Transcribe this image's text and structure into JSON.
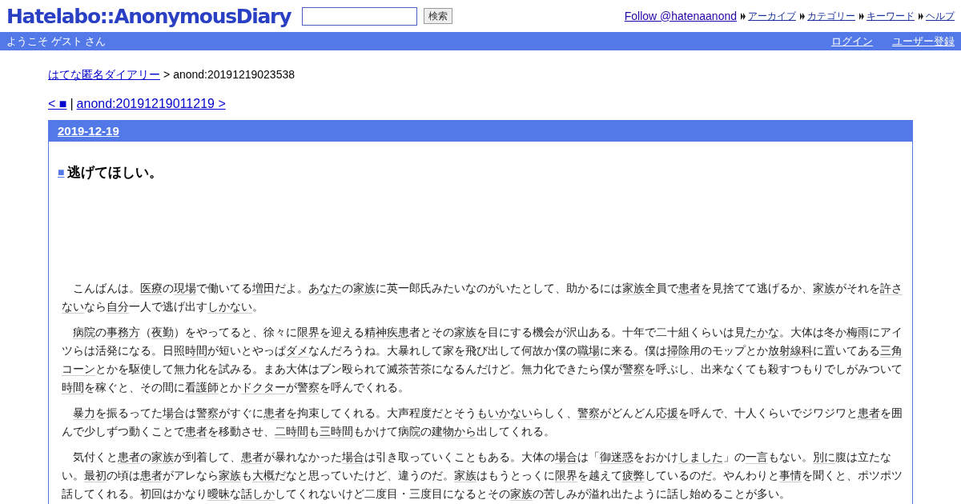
{
  "header": {
    "logo": "Hatelabo::AnonymousDiary",
    "search": {
      "button": "検索"
    },
    "follow": "Follow @hatenaanond",
    "links": [
      "アーカイブ",
      "カテゴリー",
      "キーワード",
      "ヘルプ"
    ]
  },
  "userbar": {
    "welcome": "ようこそ ゲスト さん",
    "links": [
      "ログイン",
      "ユーザー登録"
    ]
  },
  "breadcrumb": {
    "home": "はてな匿名ダイアリー",
    "separator": ">",
    "current": "anond:20191219023538"
  },
  "pager": {
    "prev": "< ■",
    "separator": "|",
    "next": "anond:20191219011219 >"
  },
  "day": {
    "date": "2019-12-19",
    "entry": {
      "mark": "■",
      "title": "逃げてほしい。",
      "paragraphs": [
        [
          {
            "text": "こんばんは。",
            "kind": "plain"
          },
          {
            "text": "医療",
            "kind": "keyword"
          },
          {
            "text": "の",
            "kind": "plain"
          },
          {
            "text": "現場",
            "kind": "keyword"
          },
          {
            "text": "で働いてる",
            "kind": "plain"
          },
          {
            "text": "増田",
            "kind": "keyword"
          },
          {
            "text": "だよ。",
            "kind": "plain"
          },
          {
            "text": "あなた",
            "kind": "keyword"
          },
          {
            "text": "の",
            "kind": "plain"
          },
          {
            "text": "家族",
            "kind": "keyword"
          },
          {
            "text": "に英一郎氏みたいなのがいたとして、助かるには",
            "kind": "plain"
          },
          {
            "text": "家族",
            "kind": "keyword"
          },
          {
            "text": "全員で",
            "kind": "plain"
          },
          {
            "text": "患者",
            "kind": "keyword"
          },
          {
            "text": "を見捨てて逃げるか、",
            "kind": "plain"
          },
          {
            "text": "家族",
            "kind": "keyword"
          },
          {
            "text": "がそれを",
            "kind": "plain"
          },
          {
            "text": "許さ",
            "kind": "keyword"
          },
          {
            "text": "ない",
            "kind": "keyword"
          },
          {
            "text": "なら",
            "kind": "plain"
          },
          {
            "text": "自分",
            "kind": "keyword"
          },
          {
            "text": "一人で逃げ出す",
            "kind": "plain"
          },
          {
            "text": "しかない",
            "kind": "keyword"
          },
          {
            "text": "。",
            "kind": "plain"
          }
        ],
        [
          {
            "text": "病院",
            "kind": "keyword"
          },
          {
            "text": "の",
            "kind": "plain"
          },
          {
            "text": "事務方",
            "kind": "keyword"
          },
          {
            "text": "（",
            "kind": "plain"
          },
          {
            "text": "夜勤",
            "kind": "keyword"
          },
          {
            "text": "）をやってると、徐々に",
            "kind": "plain"
          },
          {
            "text": "限界",
            "kind": "keyword"
          },
          {
            "text": "を迎える",
            "kind": "plain"
          },
          {
            "text": "精神疾患",
            "kind": "keyword"
          },
          {
            "text": "者とその",
            "kind": "plain"
          },
          {
            "text": "家族",
            "kind": "keyword"
          },
          {
            "text": "を目にする機会が沢山ある。十年で二十組くらいは見",
            "kind": "plain"
          },
          {
            "text": "たかな",
            "kind": "keyword"
          },
          {
            "text": "。大体は冬か",
            "kind": "plain"
          },
          {
            "text": "梅雨",
            "kind": "keyword"
          },
          {
            "text": "にアイツらは活発になる。日照",
            "kind": "plain"
          },
          {
            "text": "時間",
            "kind": "keyword"
          },
          {
            "text": "が短いとやっぱ",
            "kind": "plain"
          },
          {
            "text": "ダメ",
            "kind": "keyword"
          },
          {
            "text": "なんだろうね。大暴れして家を飛び出して何故か僕の",
            "kind": "plain"
          },
          {
            "text": "職場",
            "kind": "keyword"
          },
          {
            "text": "に来る。僕は",
            "kind": "plain"
          },
          {
            "text": "掃除",
            "kind": "keyword"
          },
          {
            "text": "用のモップとか",
            "kind": "plain"
          },
          {
            "text": "放射線科",
            "kind": "keyword"
          },
          {
            "text": "に置いてある",
            "kind": "plain"
          },
          {
            "text": "三角",
            "kind": "keyword"
          },
          {
            "text": "コーン",
            "kind": "keyword"
          },
          {
            "text": "とかを駆使して無力化を試みる。まあ大体はブン殴られて滅茶苦茶になるんだけど。無力化できたら僕が",
            "kind": "plain"
          },
          {
            "text": "警察",
            "kind": "keyword"
          },
          {
            "text": "を呼ぶし、出来なくても殺すつもりでしがみついて",
            "kind": "plain"
          },
          {
            "text": "時間",
            "kind": "keyword"
          },
          {
            "text": "を稼ぐと、その間に",
            "kind": "plain"
          },
          {
            "text": "看護師",
            "kind": "keyword"
          },
          {
            "text": "とか",
            "kind": "plain"
          },
          {
            "text": "ドクター",
            "kind": "keyword"
          },
          {
            "text": "が",
            "kind": "plain"
          },
          {
            "text": "警察",
            "kind": "keyword"
          },
          {
            "text": "を呼んでくれる。",
            "kind": "plain"
          }
        ],
        [
          {
            "text": "暴力",
            "kind": "keyword"
          },
          {
            "text": "を振るってた",
            "kind": "plain"
          },
          {
            "text": "場合",
            "kind": "keyword"
          },
          {
            "text": "は",
            "kind": "plain"
          },
          {
            "text": "警察",
            "kind": "keyword"
          },
          {
            "text": "がすぐに",
            "kind": "plain"
          },
          {
            "text": "患者",
            "kind": "keyword"
          },
          {
            "text": "を拘束してくれる。大声程度だとそう",
            "kind": "plain"
          },
          {
            "text": "もいかない",
            "kind": "keyword"
          },
          {
            "text": "らしく、",
            "kind": "plain"
          },
          {
            "text": "警察",
            "kind": "keyword"
          },
          {
            "text": "がどんどん",
            "kind": "plain"
          },
          {
            "text": "応援",
            "kind": "keyword"
          },
          {
            "text": "を呼んで、十人くらいでジワジワと",
            "kind": "plain"
          },
          {
            "text": "患者",
            "kind": "keyword"
          },
          {
            "text": "を囲んで少しずつ動くことで",
            "kind": "plain"
          },
          {
            "text": "患者",
            "kind": "keyword"
          },
          {
            "text": "を移動させ、",
            "kind": "plain"
          },
          {
            "text": "二時間",
            "kind": "keyword"
          },
          {
            "text": "も",
            "kind": "plain"
          },
          {
            "text": "三時間",
            "kind": "keyword"
          },
          {
            "text": "もかけて",
            "kind": "plain"
          },
          {
            "text": "病院",
            "kind": "keyword"
          },
          {
            "text": "の",
            "kind": "plain"
          },
          {
            "text": "建物から",
            "kind": "keyword"
          },
          {
            "text": "出してくれる。",
            "kind": "plain"
          }
        ],
        [
          {
            "text": "気付くと",
            "kind": "plain"
          },
          {
            "text": "患者",
            "kind": "keyword"
          },
          {
            "text": "の",
            "kind": "plain"
          },
          {
            "text": "家族",
            "kind": "keyword"
          },
          {
            "text": "が到着して、",
            "kind": "plain"
          },
          {
            "text": "患者",
            "kind": "keyword"
          },
          {
            "text": "が暴れなかった",
            "kind": "plain"
          },
          {
            "text": "場合",
            "kind": "keyword"
          },
          {
            "text": "は引き取っていくこともある。大体の",
            "kind": "plain"
          },
          {
            "text": "場合",
            "kind": "keyword"
          },
          {
            "text": "は「",
            "kind": "plain"
          },
          {
            "text": "御迷惑",
            "kind": "keyword"
          },
          {
            "text": "をおかけ",
            "kind": "plain"
          },
          {
            "text": "しました",
            "kind": "keyword"
          },
          {
            "text": "」の",
            "kind": "plain"
          },
          {
            "text": "一言",
            "kind": "keyword"
          },
          {
            "text": "もない。",
            "kind": "plain"
          },
          {
            "text": "別に",
            "kind": "keyword"
          },
          {
            "text": "腹は立たない。",
            "kind": "plain"
          },
          {
            "text": "最初",
            "kind": "keyword"
          },
          {
            "text": "の頃は",
            "kind": "plain"
          },
          {
            "text": "患者",
            "kind": "keyword"
          },
          {
            "text": "がアレなら",
            "kind": "plain"
          },
          {
            "text": "家族",
            "kind": "keyword"
          },
          {
            "text": "も",
            "kind": "plain"
          },
          {
            "text": "大概",
            "kind": "keyword"
          },
          {
            "text": "だなと思っていたけど、違うのだ。",
            "kind": "plain"
          },
          {
            "text": "家族",
            "kind": "keyword"
          },
          {
            "text": "はもうとっくに",
            "kind": "plain"
          },
          {
            "text": "限界",
            "kind": "keyword"
          },
          {
            "text": "を越えて",
            "kind": "plain"
          },
          {
            "text": "疲弊",
            "kind": "keyword"
          },
          {
            "text": "しているのだ。やんわりと",
            "kind": "plain"
          },
          {
            "text": "事情",
            "kind": "keyword"
          },
          {
            "text": "を聞くと、ポツポツ話してくれる。初回はかなり",
            "kind": "plain"
          },
          {
            "text": "曖昧",
            "kind": "keyword"
          },
          {
            "text": "な",
            "kind": "plain"
          },
          {
            "text": "話しか",
            "kind": "keyword"
          },
          {
            "text": "してくれないけど二度目・三度目になるとその",
            "kind": "plain"
          },
          {
            "text": "家族",
            "kind": "keyword"
          },
          {
            "text": "の苦しみが溢れ出たように話し始めることが多い。",
            "kind": "plain"
          }
        ]
      ]
    }
  }
}
